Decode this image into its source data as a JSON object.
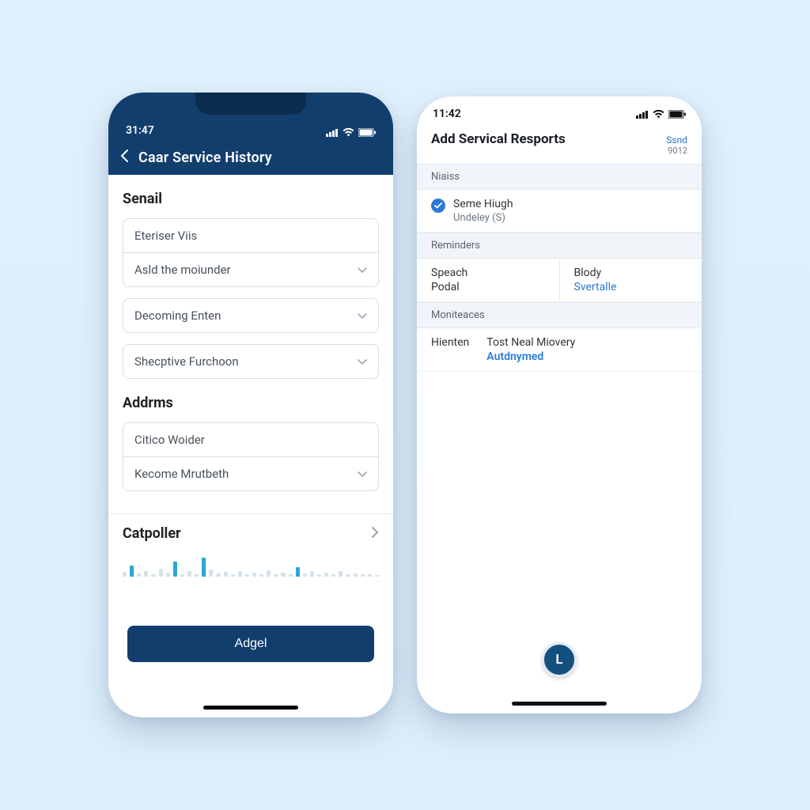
{
  "phoneA": {
    "status": {
      "time": "31:47"
    },
    "title": "Caar Service History",
    "section1": {
      "label": "Senail",
      "fields": [
        "Eteriser Viis",
        "Asld the moiunder"
      ],
      "dropdowns": [
        "Decoming Enten",
        "Shecptive Furchoon"
      ]
    },
    "section2": {
      "label": "Addrms",
      "fields": [
        "Citico Woider",
        "Kecome Mrutbeth"
      ]
    },
    "catpoller": "Catpoller",
    "cta": "Adgel"
  },
  "phoneB": {
    "status": {
      "time": "11:42"
    },
    "title": "Add Servical Resports",
    "navAction": {
      "primary": "Ssnd",
      "secondary": "9012"
    },
    "group1": {
      "header": "Niaiss",
      "row": {
        "title": "Seme Hiugh",
        "sub": "Undeley (S)"
      }
    },
    "group2": {
      "header": "Reminders",
      "left": {
        "l1": "Speach",
        "l2": "Podal"
      },
      "right": {
        "l1": "Blody",
        "link": "Svertalle"
      }
    },
    "group3": {
      "header": "Moniteaces",
      "c1": "Hienten",
      "c2": "Tost Neal Miovery",
      "link": "Autdnymed"
    },
    "fab": "L"
  }
}
